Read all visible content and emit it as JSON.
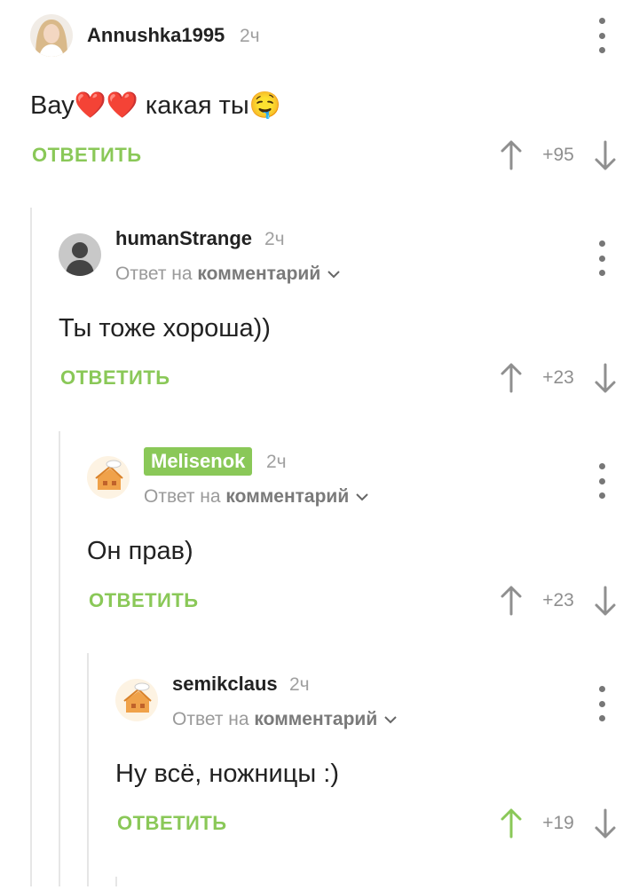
{
  "colors": {
    "accent": "#8ac858",
    "upvoted": "#8ac858",
    "arrow": "#8f8f8f"
  },
  "comments": [
    {
      "author": "Annushka1995",
      "time": "2ч",
      "reply_prefix": "",
      "reply_link": "",
      "text": "Вау❤️❤️ какая ты🤤",
      "reply_label": "ОТВЕТИТЬ",
      "score": "+95",
      "upvoted": false,
      "avatar": "photo-avatar"
    },
    {
      "author": "humanStrange",
      "time": "2ч",
      "reply_prefix": "Ответ на ",
      "reply_link": "комментарий",
      "text": "Ты тоже хороша))",
      "reply_label": "ОТВЕТИТЬ",
      "score": "+23",
      "upvoted": false,
      "avatar": "default-user-avatar"
    },
    {
      "author": "Melisenok",
      "time": "2ч",
      "reply_prefix": "Ответ на ",
      "reply_link": "комментарий",
      "text": "Он прав)",
      "reply_label": "ОТВЕТИТЬ",
      "score": "+23",
      "upvoted": false,
      "avatar": "house-avatar"
    },
    {
      "author": "semikclaus",
      "time": "2ч",
      "reply_prefix": "Ответ на ",
      "reply_link": "комментарий",
      "text": "Ну всё, ножницы :)",
      "reply_label": "ОТВЕТИТЬ",
      "score": "+19",
      "upvoted": true,
      "avatar": "house-avatar"
    }
  ]
}
